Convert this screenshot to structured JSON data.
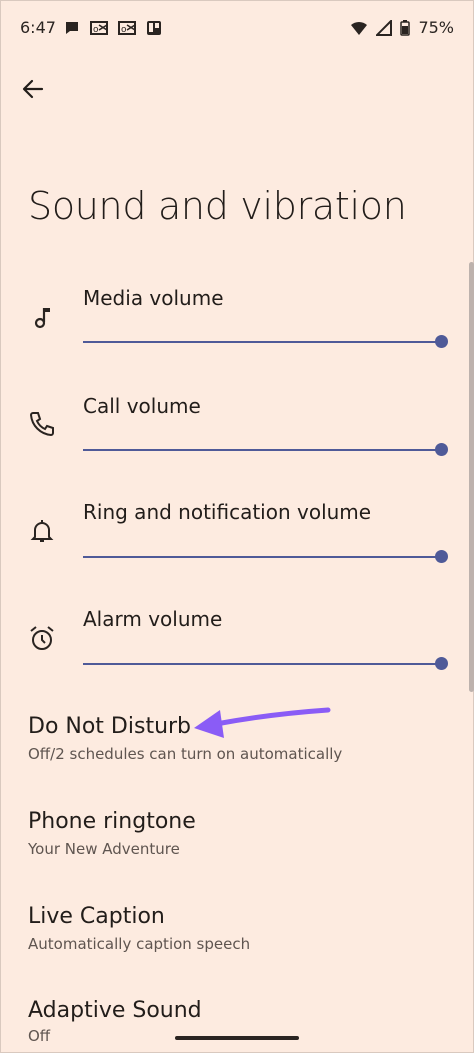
{
  "status_bar": {
    "time": "6:47",
    "battery": "75%",
    "left_icons": [
      "chat-bubble-icon",
      "outlook-icon",
      "outlook-icon",
      "trello-icon"
    ],
    "right_icons": [
      "wifi-icon",
      "signal-icon",
      "battery-icon"
    ]
  },
  "header": {
    "back_icon": "arrow-left-icon"
  },
  "page": {
    "title": "Sound and vibration"
  },
  "volumes": [
    {
      "label": "Media volume",
      "icon": "music-note-icon",
      "level": 1.0
    },
    {
      "label": "Call volume",
      "icon": "phone-icon",
      "level": 1.0
    },
    {
      "label": "Ring and notification volume",
      "icon": "bell-icon",
      "level": 1.0
    },
    {
      "label": "Alarm volume",
      "icon": "alarm-clock-icon",
      "level": 1.0
    }
  ],
  "settings": [
    {
      "title": "Do Not Disturb",
      "subtitle": "Off/2 schedules can turn on automatically"
    },
    {
      "title": "Phone ringtone",
      "subtitle": "Your New Adventure"
    },
    {
      "title": "Live Caption",
      "subtitle": "Automatically caption speech"
    },
    {
      "title": "Adaptive Sound",
      "subtitle": "Off"
    }
  ],
  "colors": {
    "background": "#fdebe0",
    "slider": "#4f5a98",
    "annotation_arrow": "#8a5cf6"
  }
}
